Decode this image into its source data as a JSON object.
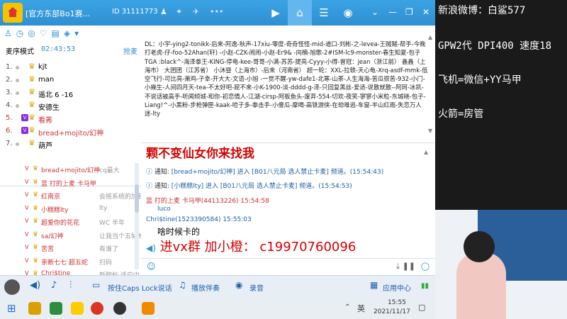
{
  "titlebar": {
    "title": "[官方东部Bo1赛...",
    "channel_id": "ID 31111773",
    "nav_icons": [
      "video-icon",
      "home-icon",
      "list-icon",
      "gamepad-icon",
      "chevron-down-icon",
      "minimize-icon",
      "restore-icon",
      "close-icon"
    ]
  },
  "left": {
    "mode_label": "麦序模式",
    "timer": "02:43:53",
    "grab_label": "抢麦",
    "queue": [
      {
        "num": "1.",
        "name": "kjt"
      },
      {
        "num": "2.",
        "name": "man"
      },
      {
        "num": "3.",
        "name": "遥北 6 -16"
      },
      {
        "num": "4.",
        "name": "安德生"
      },
      {
        "num": "5.",
        "name": "看莠",
        "badge": "V"
      },
      {
        "num": "6.",
        "name": "bread+mojito/幻神",
        "badge": "V"
      },
      {
        "num": "7.",
        "name": "葫芦"
      }
    ],
    "members": [
      {
        "name": "bread+mojito/幻神",
        "note": "cq最大"
      },
      {
        "name": "蓝 打的上麦 卡马甲",
        "note": ""
      },
      {
        "name": "红南京",
        "note": "会摇系统的加我"
      },
      {
        "name": "小糕糕lty",
        "note": "lty"
      },
      {
        "name": "超爱你的花花",
        "note": "WC 半年"
      },
      {
        "name": "sa/幻神",
        "note": "让我当个五帖枪手"
      },
      {
        "name": "苦苦",
        "note": "有谁了"
      },
      {
        "name": "亲断七七 超五蛇",
        "note": "扫码"
      },
      {
        "name": "Chri$tine",
        "note": "新聊标 适应中"
      }
    ]
  },
  "chat": {
    "bulletin": "DL：小宇-ying2-tonikk-后来-阿逸-秋声-17xiu-零度-奇奇怪怪-mid-道口-刘彬-之-levea-王贼贼-帮手-今晚打老虎-仔-foo-52Ahan(轩) -小赵-CZK-闹闹-小赵-Er9& -向楠-旭歌-2#ISM-lc9-monster-春生知夏-包子 TGA :black^-海泽拳王-KING-停电-kee-哥哥-小满-苏苏-提亮-Cyyy-小得-曾冠：jean（浙江前） 鑫鑫（上海市） 大团团（江苏省） 小沐昼（上海市）-后来（河南省） 超一轮：XXL-拉轶-天心龟-Xrq-asdf-mmk-低空飞行-可比亮-萧鸡-子幸-开大大-文语-小旭 -一觉不醒-yw-dafe1-北寒-山茶-人生海海-苦瓜很苦-932-小门-小幾生-人间四月天-tea-不太好吧-屁不来-小K-1900-淡-dddd-g-泽-只回复黑丝-爱适-说散就散--阿珂-冰凯-不说话被高手-听闻倾城-和你-初恋情人-江湖-cirsp-阿板鱼头-废弃-554-切欢-夜笑-寥寥小米粒-东城晓-包子-Liang!^-小黑粉-步枪弹匣-kaak-哈子多-拳击手-小傻瓜-摩喝-高铁游侠-在劫难逃-车窗-半山红雨-失恋万人迷-lty",
    "big_text": "颗不变仙女你来找我",
    "notices": [
      {
        "label": "通知:",
        "text": "[bread+mojito/幻神] 进入 [B01八元局 选人禁止卡麦] 频道。(15:54:43)"
      },
      {
        "label": "通知:",
        "text": "[小糕糕lty] 进入 [B01八元局 选人禁止卡麦] 频道。(15:54:53)"
      }
    ],
    "messages": [
      {
        "sender": "蓝 打的上麦 卡马甲(44113226) 15:54:58",
        "text": "luco"
      },
      {
        "sender": "Chri$tine(1523390584) 15:55:03",
        "text": "啥时候卡的"
      }
    ],
    "vx_line": "进vx群 加小橙： c19970760096"
  },
  "bottombar": {
    "caps_label": "按住Caps Lock说话",
    "accompany_label": "播放伴奏",
    "record_label": "录音",
    "app_center_label": "应用中心"
  },
  "taskbar": {
    "lang": "英",
    "time": "15:55",
    "date": "2021/11/17"
  },
  "overlay": {
    "weibo": "新浪微博：白鲨577",
    "gear": "GPW2代 DPI400 速度18",
    "plane": "飞机=微信+YY马甲",
    "rocket": "火箭=房管"
  }
}
